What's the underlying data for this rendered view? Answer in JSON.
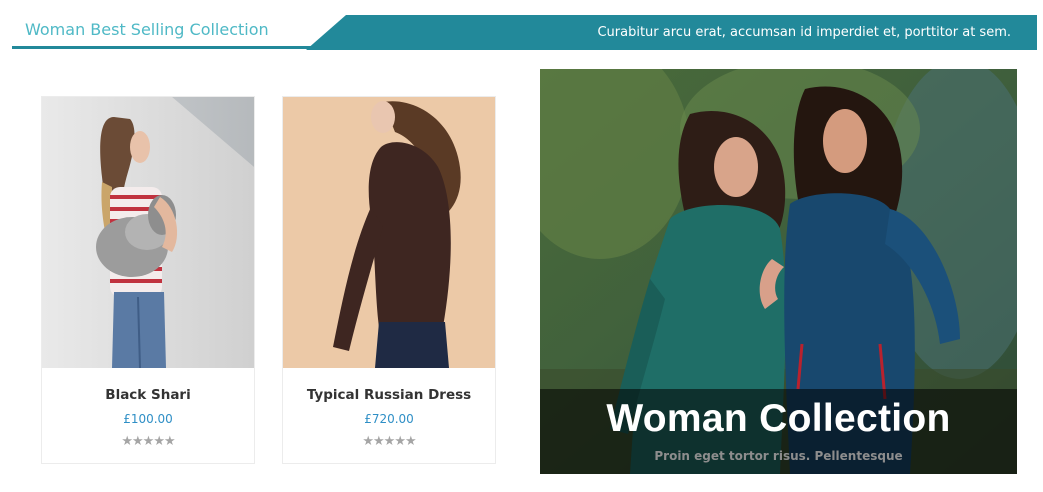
{
  "header": {
    "title": "Woman Best Selling Collection",
    "tagline": "Curabitur arcu erat, accumsan id imperdiet et, porttitor at sem.",
    "accent_color": "#22899a",
    "title_color": "#4fb9c6"
  },
  "products": [
    {
      "name": "Black Shari",
      "price": "£100.00",
      "rating_stars": "★★★★★",
      "rating": 5
    },
    {
      "name": "Typical Russian Dress",
      "price": "£720.00",
      "rating_stars": "★★★★★",
      "rating": 5
    }
  ],
  "banner": {
    "title": "Woman Collection",
    "subtitle": "Proin eget tortor risus. Pellentesque"
  }
}
